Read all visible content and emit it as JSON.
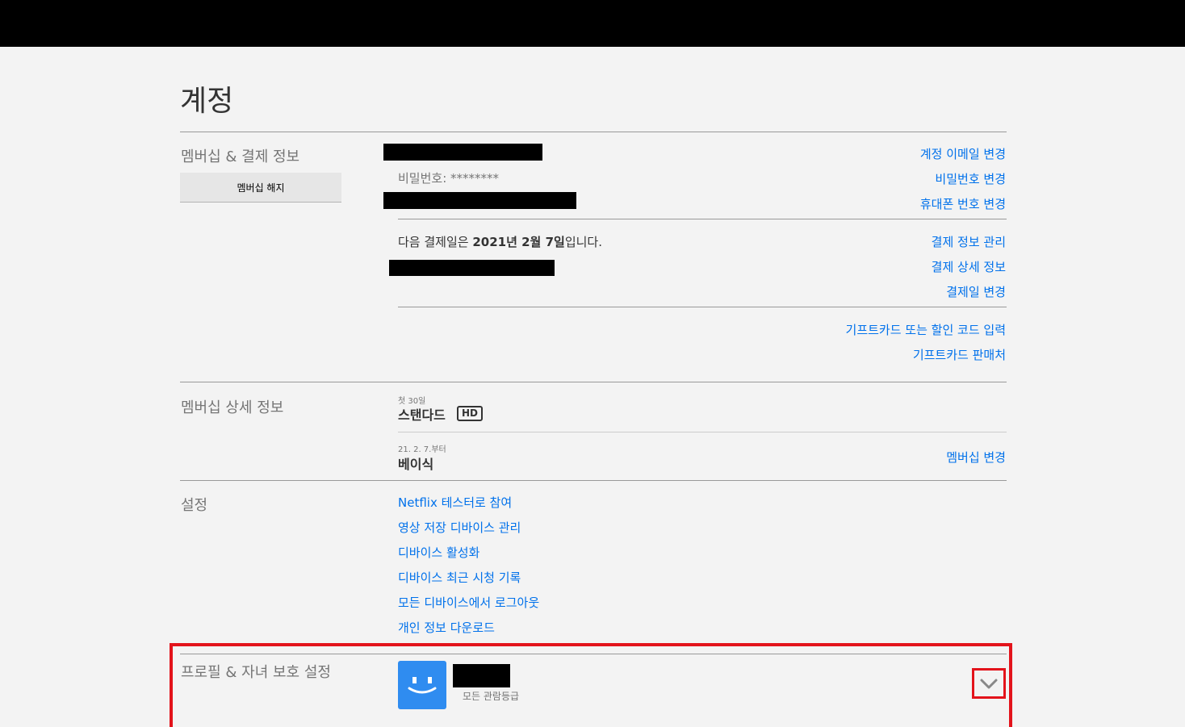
{
  "page": {
    "title": "계정"
  },
  "membership": {
    "label": "멤버십 & 결제 정보",
    "cancel_button": "멤버십 해지",
    "password": "비밀번호: ********",
    "links_account": [
      "계정 이메일 변경",
      "비밀번호 변경",
      "휴대폰 번호 변경"
    ],
    "billing_prefix": "다음 결제일은 ",
    "billing_date": "2021년 2월 7일",
    "billing_suffix": "입니다.",
    "links_billing": [
      "결제 정보 관리",
      "결제 상세 정보",
      "결제일 변경"
    ],
    "links_gift": [
      "기프트카드 또는 할인 코드 입력",
      "기프트카드 판매처"
    ]
  },
  "plan": {
    "label": "멤버십 상세 정보",
    "current_note": "첫 30일",
    "current_name": "스탠다드",
    "current_badge": "HD",
    "next_note": "21. 2. 7.부터",
    "next_name": "베이식",
    "change_link": "멤버십 변경"
  },
  "settings": {
    "label": "설정",
    "links": [
      "Netflix 테스터로 참여",
      "영상 저장 디바이스 관리",
      "디바이스 활성화",
      "디바이스 최근 시청 기록",
      "모든 디바이스에서 로그아웃",
      "개인 정보 다운로드"
    ]
  },
  "profile": {
    "label": "프로필 & 자녀 보호 설정",
    "rating": "모든 관람등급",
    "avatar_icon": "smiley-face-icon",
    "expand_icon": "chevron-down-icon"
  },
  "colors": {
    "link": "#0071eb",
    "highlight": "#e3131b",
    "avatar": "#2f8cf0"
  }
}
